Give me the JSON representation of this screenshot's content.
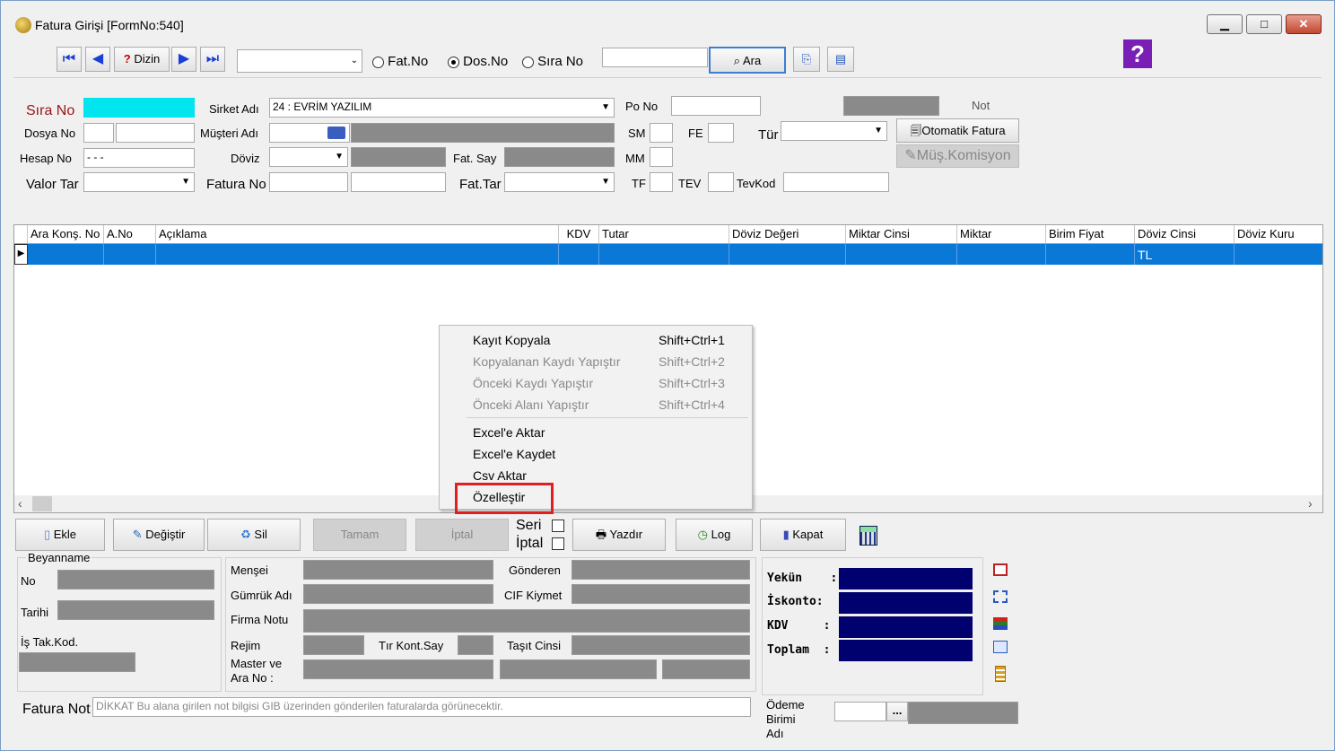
{
  "window": {
    "title": "Fatura Girişi [FormNo:540]",
    "min": "▁",
    "max": "□",
    "close": "✕"
  },
  "toolbar": {
    "first": "⏮",
    "prev": "◀",
    "dizin_label": "Dizin",
    "dizin_glyph": "?",
    "next": "▶",
    "last": "⏭",
    "combo_value": "",
    "radios": [
      {
        "label": "Fat.No",
        "selected": false
      },
      {
        "label": "Dos.No",
        "selected": true
      },
      {
        "label": "Sıra No",
        "selected": false
      }
    ],
    "search_value": "",
    "ara_label": "Ara",
    "help": "?"
  },
  "form": {
    "sira_no_label": "Sıra No",
    "sirket_adi_label": "Sirket Adı",
    "sirket_adi_value": "24 : EVRİM YAZILIM",
    "po_no_label": "Po No",
    "not_label": "Not",
    "dosya_no_label": "Dosya No",
    "musteri_adi_label": "Müşteri Adı",
    "sm_label": "SM",
    "fe_label": "FE",
    "tur_label": "Tür",
    "otomatik_fatura_label": "Otomatik Fatura",
    "mus_komisyon_label": "Müş.Komisyon",
    "hesap_no_label": "Hesap No",
    "hesap_no_value": "- - -",
    "doviz_label": "Döviz",
    "fat_say_label": "Fat. Say",
    "mm_label": "MM",
    "valor_tar_label": "Valor Tar",
    "fatura_no_label": "Fatura No",
    "fat_tar_label": "Fat.Tar",
    "tf_label": "TF",
    "tev_label": "TEV",
    "tevkod_label": "TevKod"
  },
  "grid": {
    "columns": [
      "Ara Konş. No",
      "A.No",
      "Açıklama",
      "KDV",
      "Tutar",
      "Döviz Değeri",
      "Miktar Cinsi",
      "Miktar",
      "Birim Fiyat",
      "Döviz Cinsi",
      "Döviz Kuru"
    ],
    "rows": [
      {
        "doviz_cinsi": "TL"
      }
    ]
  },
  "context_menu": {
    "items": [
      {
        "label": "Kayıt Kopyala",
        "shortcut": "Shift+Ctrl+1",
        "enabled": true
      },
      {
        "label": "Kopyalanan Kaydı Yapıştır",
        "shortcut": "Shift+Ctrl+2",
        "enabled": false
      },
      {
        "label": "Önceki Kaydı Yapıştır",
        "shortcut": "Shift+Ctrl+3",
        "enabled": false
      },
      {
        "label": "Önceki Alanı Yapıştır",
        "shortcut": "Shift+Ctrl+4",
        "enabled": false
      },
      {
        "label": "Excel'e Aktar",
        "enabled": true
      },
      {
        "label": "Excel'e Kaydet",
        "enabled": true
      },
      {
        "label": "Csv Aktar",
        "enabled": true
      },
      {
        "label": "Özelleştir",
        "enabled": true,
        "highlighted": true
      }
    ]
  },
  "actions": {
    "ekle": "Ekle",
    "degistir": "Değiştir",
    "sil": "Sil",
    "tamam": "Tamam",
    "iptal_btn": "İptal",
    "seri": "Seri",
    "iptal": "İptal",
    "yazdir": "Yazdır",
    "log": "Log",
    "kapat": "Kapat"
  },
  "beyanname": {
    "title": "Beyanname",
    "no": "No",
    "tarihi": "Tarihi",
    "is_tak_kod": "İş Tak.Kod."
  },
  "details": {
    "mensei": "Menşei",
    "gonderen": "Gönderen",
    "gumruk_adi": "Gümrük Adı",
    "cif_kiymet": "CIF Kiymet",
    "firma_notu": "Firma Notu",
    "rejim": "Rejim",
    "tir_kont_say": "Tır Kont.Say",
    "tasit_cinsi": "Taşıt Cinsi",
    "master_ve": "Master ve",
    "ara_no": "Ara No :"
  },
  "totals": {
    "yekun": "Yekün    :",
    "iskonto": "İskonto:",
    "kdv": "KDV     :",
    "toplam": "Toplam  :"
  },
  "footer": {
    "fatura_not_label": "Fatura Not",
    "fatura_not_value": "DİKKAT Bu alana girilen not bilgisi GIB üzerinden gönderilen faturalarda görünecektir.",
    "odeme_label_1": "Ödeme",
    "odeme_label_2": "Birimi",
    "odeme_label_3": "Adı",
    "odeme_btn": "..."
  },
  "colors": {
    "selection": "#0a78d7",
    "cyan": "#00e5ee",
    "navy": "#00006e",
    "highlight_box": "#e02020"
  }
}
